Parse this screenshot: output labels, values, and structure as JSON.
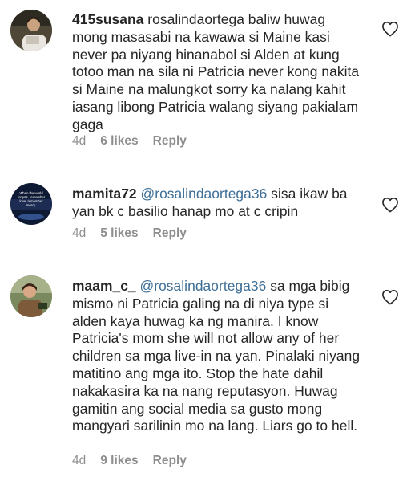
{
  "comments": [
    {
      "username": "415susana",
      "text": "rosalindaortega baliw huwag mong masasabi na kawawa si Maine kasi never pa niyang hinanabol si Alden at kung totoo man na sila ni Patricia never kong nakita si Maine na malungkot sorry ka nalang kahit iasang libong Patricia walang siyang pakialam gaga",
      "time": "4d",
      "likes": "6 likes",
      "reply": "Reply",
      "like_icon": "heart-outline-icon"
    },
    {
      "username": "mamita72",
      "mention": "@rosalindaortega36",
      "text": "sisa ikaw ba yan bk c basilio hanap mo at c cripin",
      "time": "4d",
      "likes": "5 likes",
      "reply": "Reply",
      "like_icon": "heart-outline-icon",
      "avatar_text": "When the world forgets, remember love, remember mercy."
    },
    {
      "username": "maam_c_",
      "mention": "@rosalindaortega36",
      "text": "sa mga bibig mismo ni Patricia galing na di niya type si alden kaya huwag ka ng manira. I know Patricia's mom she will not allow any of her children sa mga live-in na yan. Pinalaki niyang matitino ang mga ito. Stop the hate dahil nakakasira ka na nang reputasyon. Huwag gamitin ang social media sa gusto mong mangyari sarilinin mo na lang. Liars go to hell.",
      "time": "4d",
      "likes": "9 likes",
      "reply": "Reply",
      "like_icon": "heart-outline-icon"
    }
  ]
}
